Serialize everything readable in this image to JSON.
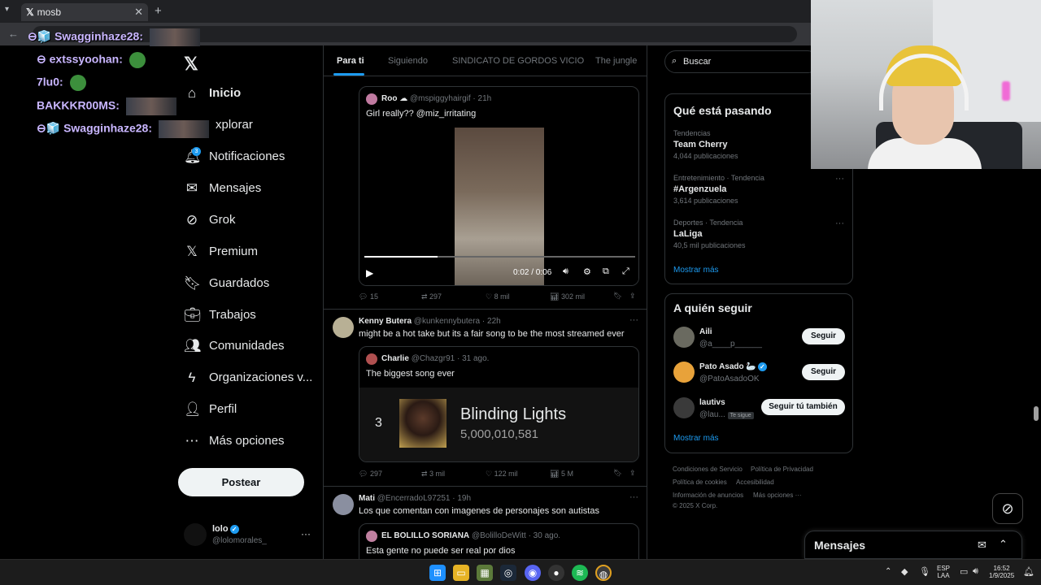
{
  "browser": {
    "tab_title": "mosb",
    "tab_close": "✕",
    "new_tab": "+"
  },
  "overlay_chat": [
    {
      "user": "Swagginhaze28:",
      "prefix": "⊖🧊"
    },
    {
      "user": "extssyoohan:",
      "prefix": "⊖"
    },
    {
      "user": "7lu0:",
      "prefix": ""
    },
    {
      "user": "BAKKKR00MS:",
      "prefix": ""
    },
    {
      "user": "Swagginhaze28:",
      "prefix": "⊖🧊"
    }
  ],
  "nav": {
    "items": [
      {
        "label": "Inicio",
        "icon": "home-icon"
      },
      {
        "label": "xplorar",
        "icon": "search-icon"
      },
      {
        "label": "Notificaciones",
        "icon": "bell-icon",
        "badge": "3"
      },
      {
        "label": "Mensajes",
        "icon": "envelope-icon"
      },
      {
        "label": "Grok",
        "icon": "grok-icon"
      },
      {
        "label": "Premium",
        "icon": "x-icon"
      },
      {
        "label": "Guardados",
        "icon": "bookmark-icon"
      },
      {
        "label": "Trabajos",
        "icon": "briefcase-icon"
      },
      {
        "label": "Comunidades",
        "icon": "people-icon"
      },
      {
        "label": "Organizaciones v...",
        "icon": "lightning-icon"
      },
      {
        "label": "Perfil",
        "icon": "person-icon"
      },
      {
        "label": "Más opciones",
        "icon": "more-circle-icon"
      }
    ],
    "post_button": "Postear"
  },
  "account": {
    "name": "lolo",
    "handle": "@lolomorales_",
    "more": "···"
  },
  "timeline_tabs": [
    "Para ti",
    "Siguiendo",
    "SINDICATO DE GORDOS VICIO",
    "The jungle"
  ],
  "tweets": [
    {
      "quote": {
        "name": "Roo",
        "emoji": "☁",
        "handle": "@mspiggyhairgif",
        "time": "· 21h",
        "text": "Girl really?? @miz_irritating"
      },
      "video": {
        "time": "0:02 / 0:06"
      },
      "actions": {
        "replies": "15",
        "retweets": "297",
        "likes": "8 mil",
        "views": "302 mil"
      }
    },
    {
      "name": "Kenny Butera",
      "handle": "@kunkennybutera",
      "time": "· 22h",
      "text": "might be a hot take but its a fair song to be the most streamed ever",
      "quote": {
        "name": "Charlie",
        "handle": "@Chazgr91",
        "time": "· 31 ago.",
        "text": "The biggest song ever"
      },
      "song": {
        "rank": "3",
        "title": "Blinding Lights",
        "streams": "5,000,010,581"
      },
      "actions": {
        "replies": "297",
        "retweets": "3 mil",
        "likes": "122 mil",
        "views": "5 M"
      }
    },
    {
      "name": "Mati",
      "handle": "@EncerradoL97251",
      "time": "· 19h",
      "text": "Los que comentan con imagenes de personajes son autistas",
      "quote": {
        "name": "EL BOLILLO SORIANA",
        "handle": "@BolilloDeWitt",
        "time": "· 30 ago.",
        "text": "Esta gente no puede ser real por dios"
      }
    }
  ],
  "search": {
    "placeholder": "Buscar"
  },
  "trends": {
    "title": "Qué está pasando",
    "items": [
      {
        "meta": "Tendencias",
        "name": "Team Cherry",
        "count": "4,044 publicaciones"
      },
      {
        "meta": "Entretenimiento · Tendencia",
        "name": "#Argenzuela",
        "count": "3,614 publicaciones"
      },
      {
        "meta": "Deportes · Tendencia",
        "name": "LaLiga",
        "count": "40,5 mil publicaciones"
      }
    ],
    "show_more": "Mostrar más"
  },
  "who_to_follow": {
    "title": "A quién seguir",
    "items": [
      {
        "name": "Aili",
        "handle": "@a____p______",
        "button": "Seguir"
      },
      {
        "name": "Pato Asado",
        "emoji": "🦢",
        "handle": "@PatoAsadoOK",
        "button": "Seguir"
      },
      {
        "name": "lautivs",
        "handle": "@lau...",
        "badge": "Te sigue",
        "button": "Seguir tú también"
      }
    ],
    "show_more": "Mostrar más"
  },
  "footer": {
    "terms": "Condiciones de Servicio",
    "privacy": "Política de Privacidad",
    "cookies": "Política de cookies",
    "accessibility": "Accesibilidad",
    "ads": "Información de anuncios",
    "more": "Más opciones ···",
    "copyright": "© 2025 X Corp."
  },
  "messages_drawer": {
    "title": "Mensajes"
  },
  "taskbar": {
    "lang": "ESP",
    "layout": "LAA",
    "time": "16:52",
    "date": "1/9/2025"
  },
  "colors": {
    "accent": "#1d9bf0",
    "bg": "#000000",
    "border": "#2f3336",
    "muted": "#71767b"
  }
}
